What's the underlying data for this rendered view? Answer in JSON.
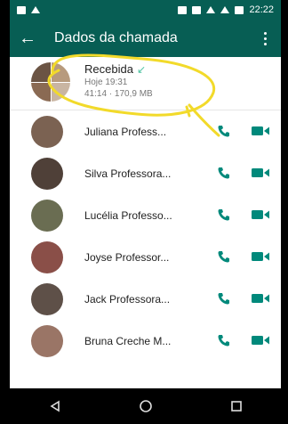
{
  "statusbar": {
    "time": "22:22"
  },
  "appbar": {
    "title": "Dados da chamada"
  },
  "call": {
    "title": "Recebida",
    "arrow": "↙",
    "date": "Hoje 19:31",
    "duration_size": "41:14 · 170,9 MB"
  },
  "participants": [
    {
      "name": "Juliana Profess...",
      "avatar_color": "#7b6252"
    },
    {
      "name": "Silva Professora...",
      "avatar_color": "#4f4038"
    },
    {
      "name": "Lucélia Professo...",
      "avatar_color": "#6a6d52"
    },
    {
      "name": "Joyse Professor...",
      "avatar_color": "#8a4f48"
    },
    {
      "name": "Jack Professora...",
      "avatar_color": "#5e5048"
    },
    {
      "name": "Bruna Creche M...",
      "avatar_color": "#9a7566"
    }
  ],
  "colors": {
    "accent": "#075e54",
    "icon_green": "#00897b",
    "annotation": "#f2da2a"
  },
  "icons": {
    "back": "arrow-left-icon",
    "menu": "more-vertical-icon",
    "call": "phone-icon",
    "video": "video-icon",
    "nav_back": "triangle-back-icon",
    "nav_home": "circle-home-icon",
    "nav_recent": "square-recents-icon"
  }
}
